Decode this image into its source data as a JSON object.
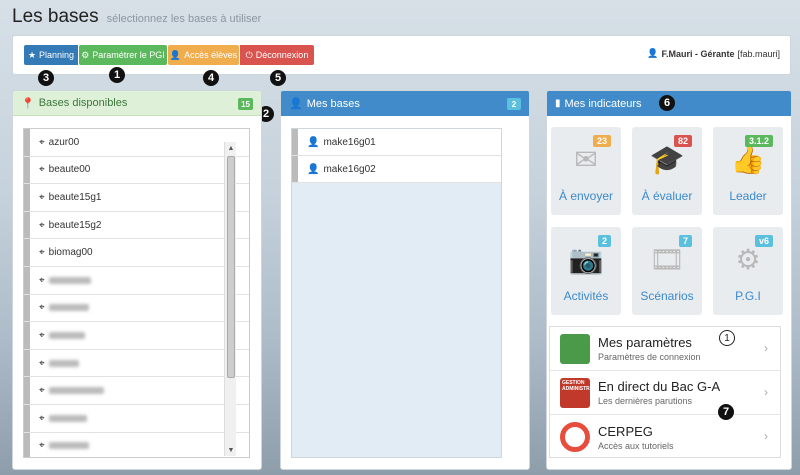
{
  "header": {
    "title": "Les bases",
    "subtitle": "sélectionnez les bases à utiliser"
  },
  "toolbar": {
    "planning_label": "Planning",
    "pgi_label": "Paramétrer le PGI",
    "eleves_label": "Accès élèves",
    "deco_label": "Déconnexion"
  },
  "user": {
    "name": "F.Mauri - Gérante",
    "login": "[fab.mauri]"
  },
  "annotations": {
    "n1": "1",
    "n2": "2",
    "n3": "3",
    "n4": "4",
    "n5": "5",
    "n6": "6",
    "n7": "7",
    "n1_outline": "1"
  },
  "available": {
    "title": "Bases disponibles",
    "count": "15",
    "items": [
      "azur00",
      "beaute00",
      "beaute15g1",
      "beaute15g2",
      "biomag00"
    ]
  },
  "mine": {
    "title": "Mes bases",
    "count": "2",
    "items": [
      "make16g01",
      "make16g02"
    ]
  },
  "indicators": {
    "title": "Mes indicateurs",
    "tiles": [
      {
        "label": "À envoyer",
        "badge": "23",
        "icon": "envelope-icon"
      },
      {
        "label": "À évaluer",
        "badge": "82",
        "icon": "graduation-cap-icon"
      },
      {
        "label": "Leader",
        "badge": "3.1.2",
        "icon": "thumbs-up-icon"
      },
      {
        "label": "Activités",
        "badge": "2",
        "icon": "camera-icon"
      },
      {
        "label": "Scénarios",
        "badge": "7",
        "icon": "video-file-icon"
      },
      {
        "label": "P.G.I",
        "badge": "v6",
        "icon": "gears-icon"
      }
    ]
  },
  "links": [
    {
      "title": "Mes paramètres",
      "sub": "Paramètres de connexion"
    },
    {
      "title": "En direct du Bac G-A",
      "sub": "Les dernières parutions",
      "thumb_text": "GESTION ADMINISTRATION"
    },
    {
      "title": "CERPEG",
      "sub": "Accès aux tutoriels"
    }
  ]
}
